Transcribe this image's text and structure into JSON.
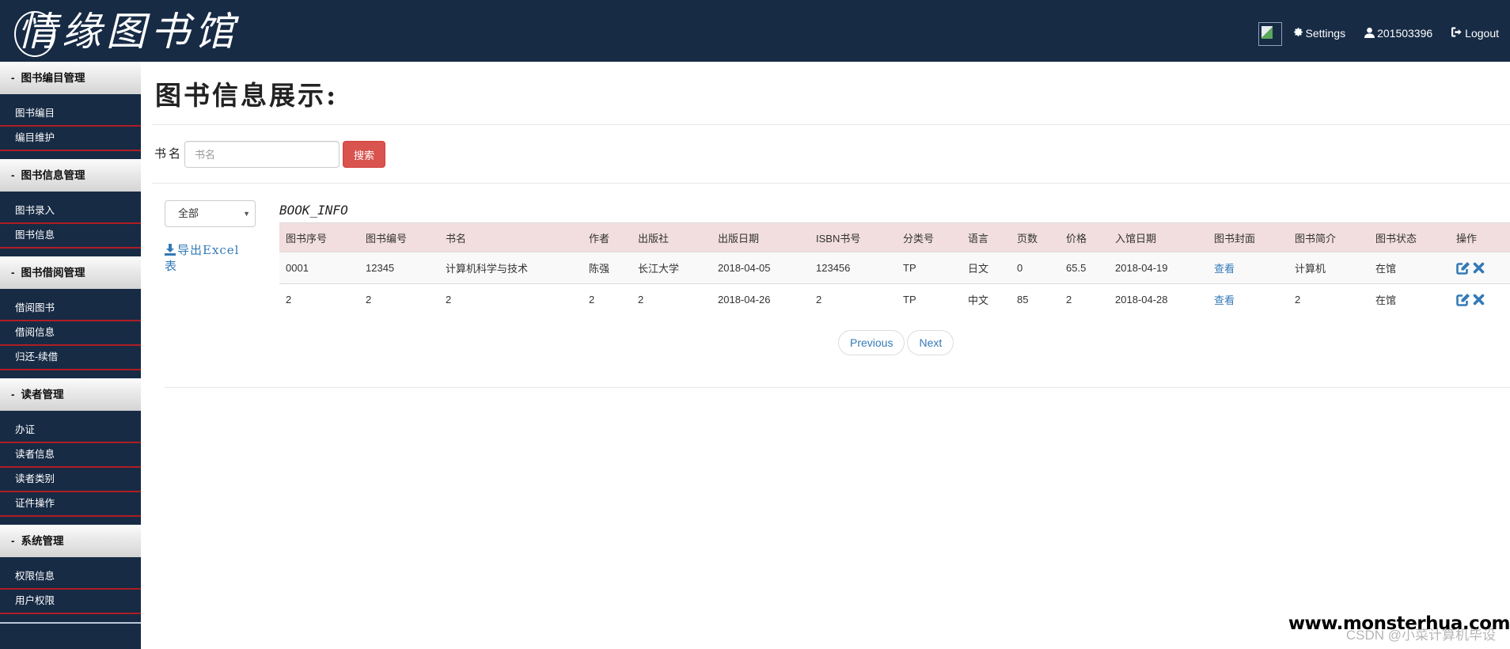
{
  "header": {
    "brand": "情缘图书馆",
    "brand_first_char": "情",
    "brand_rest": "缘图书馆",
    "settings_label": "Settings",
    "user_label": "201503396",
    "logout_label": "Logout"
  },
  "sidebar": {
    "groups": [
      {
        "title": "图书编目管理",
        "items": [
          "图书编目",
          "编目维护"
        ]
      },
      {
        "title": "图书信息管理",
        "items": [
          "图书录入",
          "图书信息"
        ]
      },
      {
        "title": "图书借阅管理",
        "items": [
          "借阅图书",
          "借阅信息",
          "归还-续借"
        ]
      },
      {
        "title": "读者管理",
        "items": [
          "办证",
          "读者信息",
          "读者类别",
          "证件操作"
        ]
      },
      {
        "title": "系统管理",
        "items": [
          "权限信息",
          "用户权限"
        ]
      }
    ],
    "dash": "-"
  },
  "main": {
    "page_title": "图书信息展示:",
    "search": {
      "label": "书名",
      "value": "",
      "placeholder": "书名",
      "button_label": "搜索"
    },
    "filter": {
      "selected": "全部"
    },
    "export_label": "导出Excel表",
    "table": {
      "caption": "BOOK_INFO",
      "columns": [
        "图书序号",
        "图书编号",
        "书名",
        "作者",
        "出版社",
        "出版日期",
        "ISBN书号",
        "分类号",
        "语言",
        "页数",
        "价格",
        "入馆日期",
        "图书封面",
        "图书简介",
        "图书状态",
        "操作"
      ],
      "rows": [
        [
          "0001",
          "12345",
          "计算机科学与技术",
          "陈强",
          "长江大学",
          "2018-04-05",
          "123456",
          "TP",
          "日文",
          "0",
          "65.5",
          "2018-04-19",
          "查看",
          "计算机",
          "在馆"
        ],
        [
          "2",
          "2",
          "2",
          "2",
          "2",
          "2018-04-26",
          "2",
          "TP",
          "中文",
          "85",
          "2",
          "2018-04-28",
          "查看",
          "2",
          "在馆"
        ]
      ]
    },
    "pager": {
      "previous_label": "Previous",
      "next_label": "Next"
    }
  },
  "watermark": {
    "site": "www.monsterhua.com",
    "csdn": "CSDN @小菜计算机毕设"
  },
  "colors": {
    "header_bg": "#172b45",
    "accent_red": "#d9534f",
    "link_blue": "#337ab7",
    "table_head_bg": "#f2dede",
    "sidebar_divider": "#b01d24"
  }
}
